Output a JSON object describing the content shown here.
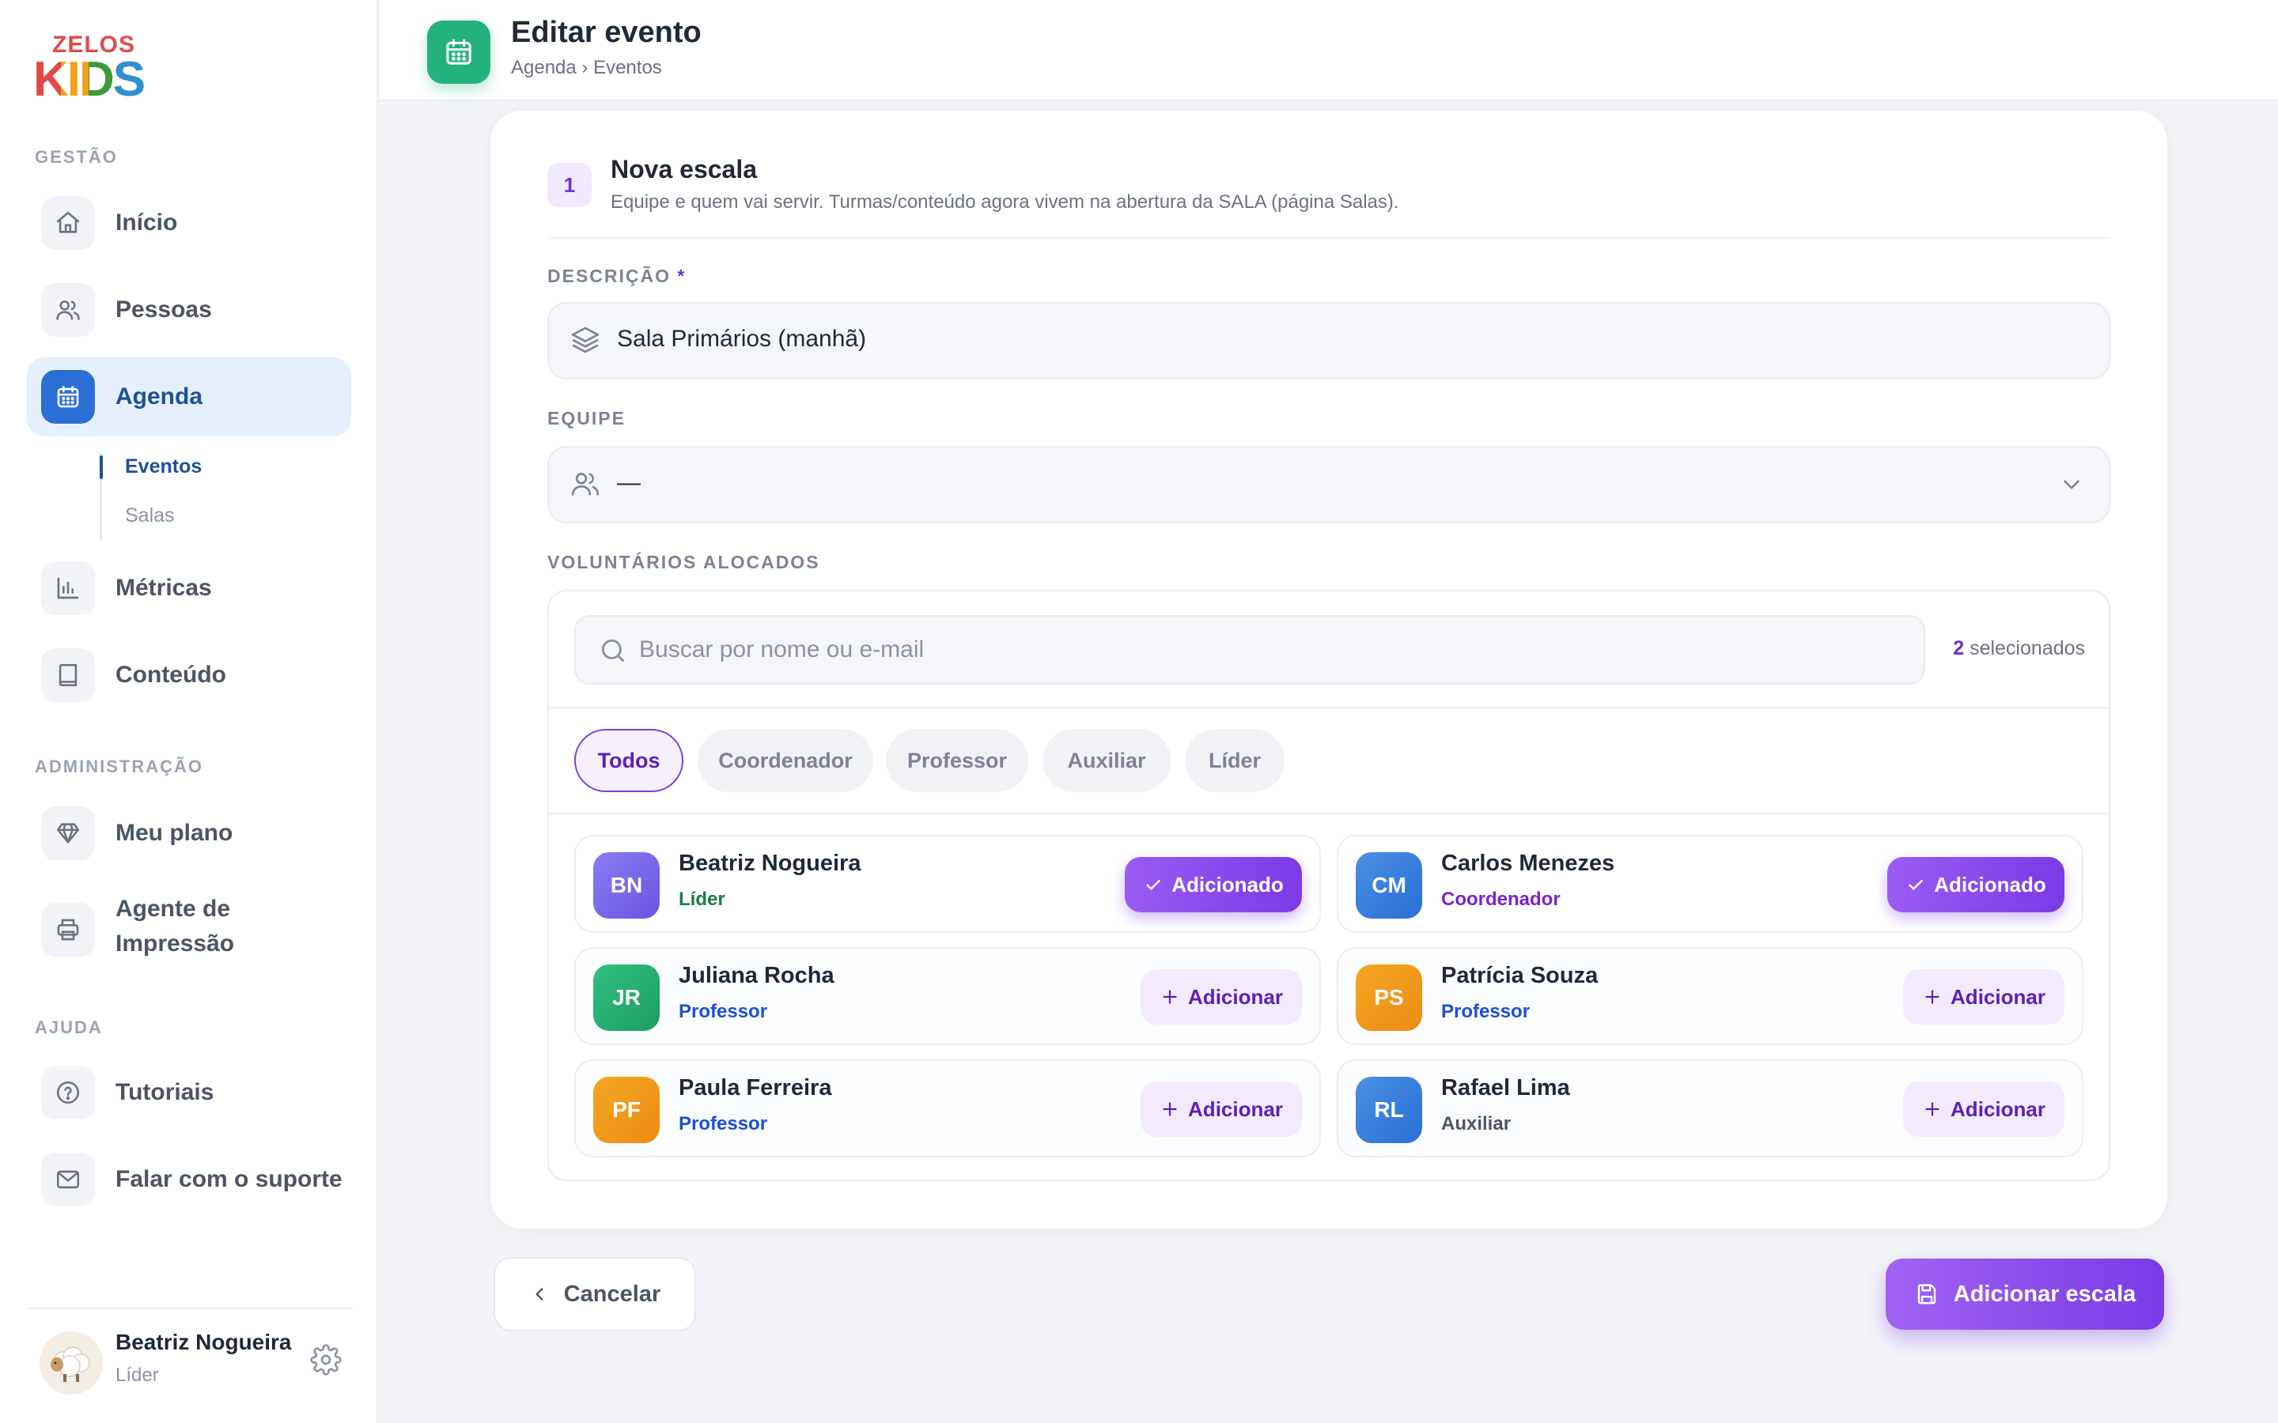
{
  "brand": {
    "line1": "ZELOS",
    "line2": "KIDS"
  },
  "sidebar": {
    "sections": {
      "gestao": "GESTÃO",
      "administracao": "ADMINISTRAÇÃO",
      "ajuda": "AJUDA"
    },
    "items": {
      "inicio": {
        "label": "Início",
        "icon": "home-icon"
      },
      "pessoas": {
        "label": "Pessoas",
        "icon": "users-icon"
      },
      "agenda": {
        "label": "Agenda",
        "icon": "calendar-icon",
        "active": true
      },
      "metricas": {
        "label": "Métricas",
        "icon": "bar-chart-icon"
      },
      "conteudo": {
        "label": "Conteúdo",
        "icon": "book-icon"
      },
      "meu_plano": {
        "label": "Meu plano",
        "icon": "diamond-icon"
      },
      "agente_line1": "Agente de",
      "agente_line2": "Impressão",
      "tutoriais": {
        "label": "Tutoriais",
        "icon": "help-circle-icon"
      },
      "suporte": {
        "label": "Falar com o suporte",
        "icon": "mail-icon"
      }
    },
    "subitems": {
      "eventos": "Eventos",
      "salas": "Salas"
    },
    "user": {
      "name": "Beatriz Nogueira",
      "role": "Líder"
    }
  },
  "header": {
    "title": "Editar evento",
    "breadcrumb": "Agenda › Eventos"
  },
  "form": {
    "step_number": "1",
    "step_title": "Nova escala",
    "step_subtitle": "Equipe e quem vai servir. Turmas/conteúdo agora vivem na abertura da SALA (página Salas).",
    "descricao_label": "DESCRIÇÃO",
    "required_mark": "*",
    "descricao_value": "Sala Primários (manhã)",
    "equipe_label": "EQUIPE",
    "equipe_value": "—",
    "voluntarios_label": "VOLUNTÁRIOS ALOCADOS",
    "search_placeholder": "Buscar por nome ou e-mail",
    "selected_count": "2",
    "selected_suffix": "selecionados",
    "filters": [
      "Todos",
      "Coordenador",
      "Professor",
      "Auxiliar",
      "Líder"
    ],
    "volunteers": [
      {
        "initials": "BN",
        "name": "Beatriz Nogueira",
        "role": "Líder",
        "button": "Adicionado",
        "added": true
      },
      {
        "initials": "CM",
        "name": "Carlos Menezes",
        "role": "Coordenador",
        "button": "Adicionado",
        "added": true
      },
      {
        "initials": "JR",
        "name": "Juliana Rocha",
        "role": "Professor",
        "button": "Adicionar",
        "added": false
      },
      {
        "initials": "PS",
        "name": "Patrícia Souza",
        "role": "Professor",
        "button": "Adicionar",
        "added": false
      },
      {
        "initials": "PF",
        "name": "Paula Ferreira",
        "role": "Professor",
        "button": "Adicionar",
        "added": false
      },
      {
        "initials": "RL",
        "name": "Rafael Lima",
        "role": "Auxiliar",
        "button": "Adicionar",
        "added": false
      }
    ]
  },
  "actions": {
    "cancel": "Cancelar",
    "submit": "Adicionar escala"
  },
  "colors": {
    "accent_purple": "#7a3be6",
    "nav_active_blue": "#2a6fd6",
    "header_icon_green": "#24b27c",
    "role_lider": "#15803d",
    "role_coordenador": "#7e22ce",
    "role_professor": "#1d4ed8",
    "role_auxiliar": "#4b5563"
  }
}
